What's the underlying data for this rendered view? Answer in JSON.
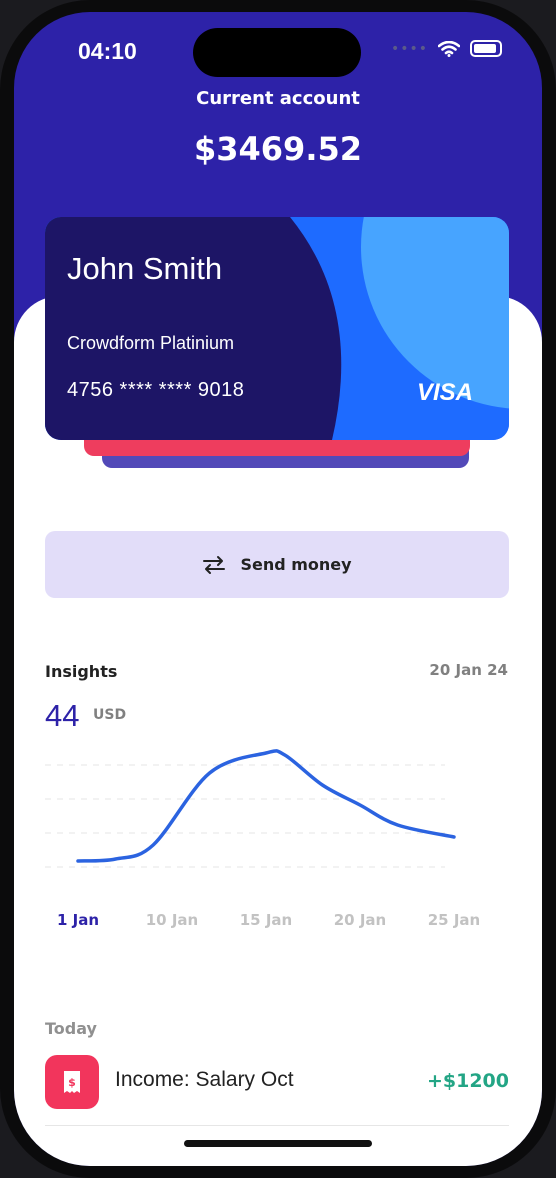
{
  "status_bar": {
    "time": "04:10",
    "icons": [
      "cellular-icon",
      "wifi-icon",
      "battery-icon"
    ]
  },
  "header": {
    "title": "Current account",
    "balance": "$3469.52"
  },
  "card": {
    "holder": "John Smith",
    "product": "Crowdform Platinium",
    "number": "4756 **** **** 9018",
    "network": "VISA"
  },
  "actions": {
    "send_money": "Send money",
    "send_icon": "transfer-arrows-icon"
  },
  "insights": {
    "label": "Insights",
    "date": "20 Jan 24",
    "value": "44",
    "unit": "USD"
  },
  "chart_data": {
    "type": "line",
    "categories": [
      "1 Jan",
      "10 Jan",
      "15 Jan",
      "20 Jan",
      "25 Jan"
    ],
    "active_category": "1 Jan",
    "x": [
      0,
      0.1,
      0.2,
      0.35,
      0.5,
      0.55,
      0.65,
      0.75,
      0.85,
      1.0
    ],
    "values": [
      2,
      2.5,
      6,
      24,
      29,
      28.5,
      21,
      16,
      11,
      8
    ],
    "ylim": [
      0,
      32
    ],
    "grid": "horizontal-dashed",
    "line_color": "#2b63e0"
  },
  "transactions": {
    "section": "Today",
    "items": [
      {
        "label": "Income: Salary Oct",
        "amount": "+$1200",
        "icon": "receipt-dollar-icon"
      }
    ]
  },
  "colors": {
    "primary": "#2d22a8",
    "card_dark": "#1d1566",
    "card_blue": "#1e6bff",
    "card_light": "#47a4ff",
    "accent_red": "#f2355c",
    "positive": "#23a585",
    "button_bg": "#e2ddf9"
  }
}
